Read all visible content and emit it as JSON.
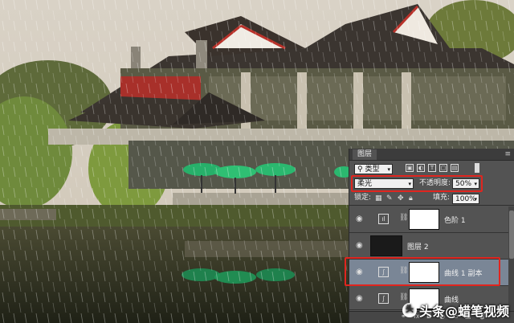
{
  "panel": {
    "tab_label": "图层",
    "filter_kind": "类型",
    "blend_mode": "柔光",
    "opacity_label": "不透明度:",
    "opacity_value": "50%",
    "lock_label": "锁定:",
    "fill_label": "填充:",
    "fill_value": "100%",
    "layers": [
      {
        "name": "色阶 1",
        "type": "adjustment",
        "icon": "levels-icon"
      },
      {
        "name": "图层 2",
        "type": "pixel",
        "icon": "dark-thumbnail"
      },
      {
        "name": "曲线 1 副本",
        "type": "adjustment",
        "icon": "curves-icon",
        "selected": true
      },
      {
        "name": "曲线",
        "type": "adjustment",
        "icon": "curves-icon"
      }
    ]
  },
  "watermark": {
    "text": "头条@蜡笔视频",
    "logo": "头"
  },
  "colors": {
    "highlight": "#e0251f",
    "selected_row": "#7a8696",
    "panel_bg": "#535353"
  }
}
